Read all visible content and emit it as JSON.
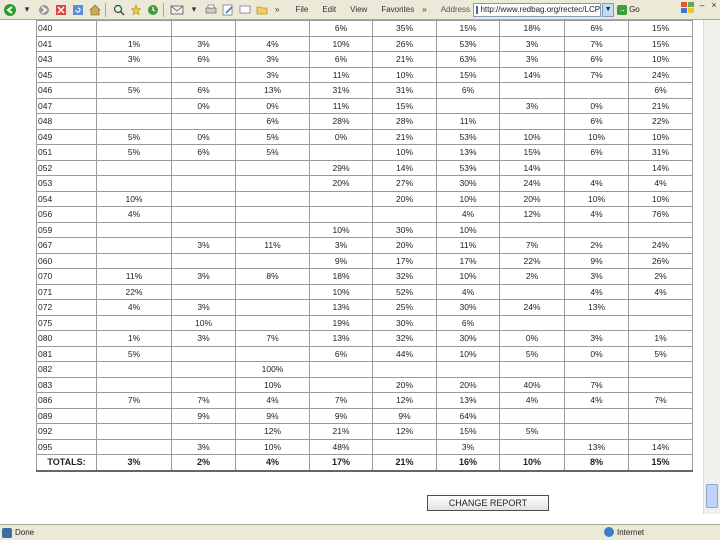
{
  "toolbar": {
    "back_icon": "back-arrow-icon",
    "menus": [
      "File",
      "Edit",
      "View",
      "Favorites"
    ],
    "chevron": "»",
    "address_label": "Address",
    "address_value": "http://www.redbag.org/rectec/LCP",
    "go_label": "Go",
    "window_controls": [
      "–",
      "×"
    ]
  },
  "table": {
    "rows": [
      {
        "label": "040",
        "cells": [
          "",
          "",
          "",
          "6%",
          "35%",
          "15%",
          "18%",
          "6%",
          "15%"
        ]
      },
      {
        "label": "041",
        "cells": [
          "1%",
          "3%",
          "4%",
          "10%",
          "26%",
          "53%",
          "3%",
          "7%",
          "15%"
        ]
      },
      {
        "label": "043",
        "cells": [
          "3%",
          "6%",
          "3%",
          "6%",
          "21%",
          "63%",
          "3%",
          "6%",
          "10%"
        ]
      },
      {
        "label": "045",
        "cells": [
          "",
          "",
          "3%",
          "11%",
          "10%",
          "15%",
          "14%",
          "7%",
          "24%"
        ]
      },
      {
        "label": "046",
        "cells": [
          "5%",
          "6%",
          "13%",
          "31%",
          "31%",
          "6%",
          "",
          "",
          "6%"
        ]
      },
      {
        "label": "047",
        "cells": [
          "",
          "0%",
          "0%",
          "11%",
          "15%",
          "",
          "3%",
          "0%",
          "21%"
        ]
      },
      {
        "label": "048",
        "cells": [
          "",
          "",
          "6%",
          "28%",
          "28%",
          "11%",
          "",
          "6%",
          "22%"
        ]
      },
      {
        "label": "049",
        "cells": [
          "5%",
          "0%",
          "5%",
          "0%",
          "21%",
          "53%",
          "10%",
          "10%",
          "10%"
        ]
      },
      {
        "label": "051",
        "cells": [
          "5%",
          "6%",
          "5%",
          "",
          "10%",
          "13%",
          "15%",
          "6%",
          "31%"
        ]
      },
      {
        "label": "052",
        "cells": [
          "",
          "",
          "",
          "29%",
          "14%",
          "53%",
          "14%",
          "",
          "14%"
        ]
      },
      {
        "label": "053",
        "cells": [
          "",
          "",
          "",
          "20%",
          "27%",
          "30%",
          "24%",
          "4%",
          "4%"
        ]
      },
      {
        "label": "054",
        "cells": [
          "10%",
          "",
          "",
          "",
          "20%",
          "10%",
          "20%",
          "10%",
          "10%"
        ]
      },
      {
        "label": "056",
        "cells": [
          "4%",
          "",
          "",
          "",
          "",
          "4%",
          "12%",
          "4%",
          "76%"
        ]
      },
      {
        "label": "059",
        "cells": [
          "",
          "",
          "",
          "10%",
          "30%",
          "10%",
          "",
          "",
          ""
        ]
      },
      {
        "label": "067",
        "cells": [
          "",
          "3%",
          "11%",
          "3%",
          "20%",
          "11%",
          "7%",
          "2%",
          "24%"
        ]
      },
      {
        "label": "060",
        "cells": [
          "",
          "",
          "",
          "9%",
          "17%",
          "17%",
          "22%",
          "9%",
          "26%"
        ]
      },
      {
        "label": "070",
        "cells": [
          "11%",
          "3%",
          "8%",
          "18%",
          "32%",
          "10%",
          "2%",
          "3%",
          "2%"
        ]
      },
      {
        "label": "071",
        "cells": [
          "22%",
          "",
          "",
          "10%",
          "52%",
          "4%",
          "",
          "4%",
          "4%"
        ]
      },
      {
        "label": "072",
        "cells": [
          "4%",
          "3%",
          "",
          "13%",
          "25%",
          "30%",
          "24%",
          "13%",
          ""
        ]
      },
      {
        "label": "075",
        "cells": [
          "",
          "10%",
          "",
          "19%",
          "30%",
          "6%",
          "",
          "",
          ""
        ]
      },
      {
        "label": "080",
        "cells": [
          "1%",
          "3%",
          "7%",
          "13%",
          "32%",
          "30%",
          "0%",
          "3%",
          "1%"
        ]
      },
      {
        "label": "081",
        "cells": [
          "5%",
          "",
          "",
          "6%",
          "44%",
          "10%",
          "5%",
          "0%",
          "5%"
        ]
      },
      {
        "label": "082",
        "cells": [
          "",
          "",
          "100%",
          "",
          "",
          "",
          "",
          "",
          ""
        ]
      },
      {
        "label": "083",
        "cells": [
          "",
          "",
          "10%",
          "",
          "20%",
          "20%",
          "40%",
          "7%",
          ""
        ]
      },
      {
        "label": "086",
        "cells": [
          "7%",
          "7%",
          "4%",
          "7%",
          "12%",
          "13%",
          "4%",
          "4%",
          "7%"
        ]
      },
      {
        "label": "089",
        "cells": [
          "",
          "9%",
          "9%",
          "9%",
          "9%",
          "64%",
          "",
          "",
          ""
        ]
      },
      {
        "label": "092",
        "cells": [
          "",
          "",
          "12%",
          "21%",
          "12%",
          "15%",
          "5%",
          "",
          ""
        ]
      },
      {
        "label": "095",
        "cells": [
          "",
          "3%",
          "10%",
          "48%",
          "",
          "3%",
          "",
          "13%",
          "14%"
        ]
      }
    ],
    "totals": {
      "label": "TOTALS:",
      "cells": [
        "3%",
        "2%",
        "4%",
        "17%",
        "21%",
        "16%",
        "10%",
        "8%",
        "15%"
      ]
    }
  },
  "change_report_label": "CHANGE REPORT",
  "status": {
    "left_text": "Done",
    "zone_text": "Internet"
  }
}
